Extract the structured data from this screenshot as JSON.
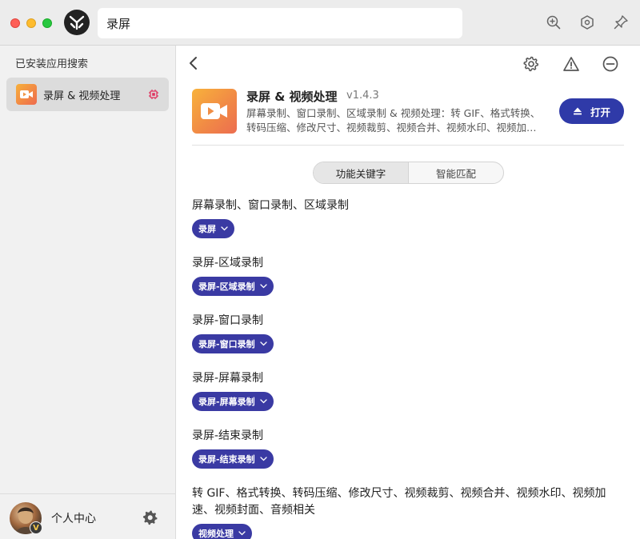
{
  "titlebar": {
    "search_value": "录屏",
    "icons": [
      "zoom-in-icon",
      "hexagon-icon",
      "pin-icon"
    ]
  },
  "sidebar": {
    "title": "已安装应用搜索",
    "items": [
      {
        "label": "录屏 & 视频处理",
        "icon": "screen-record-app-icon",
        "badge_icon": "chip-icon"
      }
    ],
    "footer": {
      "user_label": "个人中心",
      "badge": "V"
    }
  },
  "plugin": {
    "name": "录屏 & 视频处理",
    "version": "v1.4.3",
    "description": "屏幕录制、窗口录制、区域录制 & 视频处理：转 GIF、格式转换、转码压缩、修改尺寸、视频裁剪、视频合并、视频水印、视频加速、视频封面、音频相关",
    "open_label": "打开"
  },
  "tabs": [
    {
      "label": "功能关键字",
      "active": true
    },
    {
      "label": "智能匹配",
      "active": false
    }
  ],
  "keywords": [
    {
      "title": "屏幕录制、窗口录制、区域录制",
      "chip": "录屏"
    },
    {
      "title": "录屏-区域录制",
      "chip": "录屏-区域录制"
    },
    {
      "title": "录屏-窗口录制",
      "chip": "录屏-窗口录制"
    },
    {
      "title": "录屏-屏幕录制",
      "chip": "录屏-屏幕录制"
    },
    {
      "title": "录屏-结束录制",
      "chip": "录屏-结束录制"
    },
    {
      "title": "转 GIF、格式转换、转码压缩、修改尺寸、视频裁剪、视频合并、视频水印、视频加速、视频封面、音频相关",
      "chip": "视频处理"
    }
  ],
  "colors": {
    "accent": "#2f3aa8",
    "chip": "#3a3aa3",
    "titlebar": "#ececec",
    "sidebar": "#f1f1f1",
    "app_icon_gradient": [
      "#f8b23b",
      "#ec6d50"
    ]
  }
}
